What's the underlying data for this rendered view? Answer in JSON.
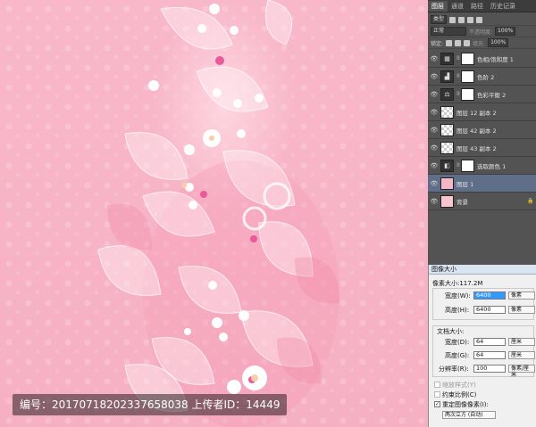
{
  "watermark": "编号：20170718202337658038 上传者ID：14449",
  "panel": {
    "tabs": [
      "图层",
      "通道",
      "路径",
      "历史记录"
    ],
    "filter_label": "类型",
    "blend_mode": "正常",
    "opacity_label": "不透明度:",
    "opacity_value": "100%",
    "lock_label": "锁定:",
    "fill_label": "填充:",
    "fill_value": "100%",
    "layers": [
      {
        "name": "色相/饱和度 1",
        "thumb": "adj",
        "icon": "▦",
        "mask": true
      },
      {
        "name": "色阶 2",
        "thumb": "adj",
        "icon": "▟",
        "mask": true
      },
      {
        "name": "色彩平衡 2",
        "thumb": "adj",
        "icon": "⚖",
        "mask": true
      },
      {
        "name": "图层 12 副本 2",
        "thumb": "checker",
        "mask": false
      },
      {
        "name": "图层 42 副本 2",
        "thumb": "checker",
        "mask": false
      },
      {
        "name": "图层 43 副本 2",
        "thumb": "checker",
        "mask": false
      },
      {
        "name": "选取颜色 1",
        "thumb": "adj",
        "icon": "◧",
        "mask": true
      },
      {
        "name": "图层 1",
        "thumb": "pink",
        "mask": false,
        "selected": true
      },
      {
        "name": "背景",
        "thumb": "lightpink",
        "mask": false,
        "locked": true
      }
    ]
  },
  "dialog": {
    "title": "图像大小",
    "pixel_dims": "像素大小:117.2M",
    "width_label": "宽度(W):",
    "width_value": "6400",
    "width_unit": "像素",
    "height_label": "高度(H):",
    "height_value": "6400",
    "height_unit": "像素",
    "doc_size": "文档大小:",
    "doc_width_label": "宽度(D):",
    "doc_width_value": "64",
    "doc_width_unit": "厘米",
    "doc_height_label": "高度(G):",
    "doc_height_value": "64",
    "doc_height_unit": "厘米",
    "resolution_label": "分辨率(R):",
    "resolution_value": "100",
    "resolution_unit": "像素/厘米",
    "scale_styles": "缩放样式(Y)",
    "constrain": "约束比例(C)",
    "resample": "重定图像像素(I):",
    "resample_method": "两次立方 (自动)"
  }
}
